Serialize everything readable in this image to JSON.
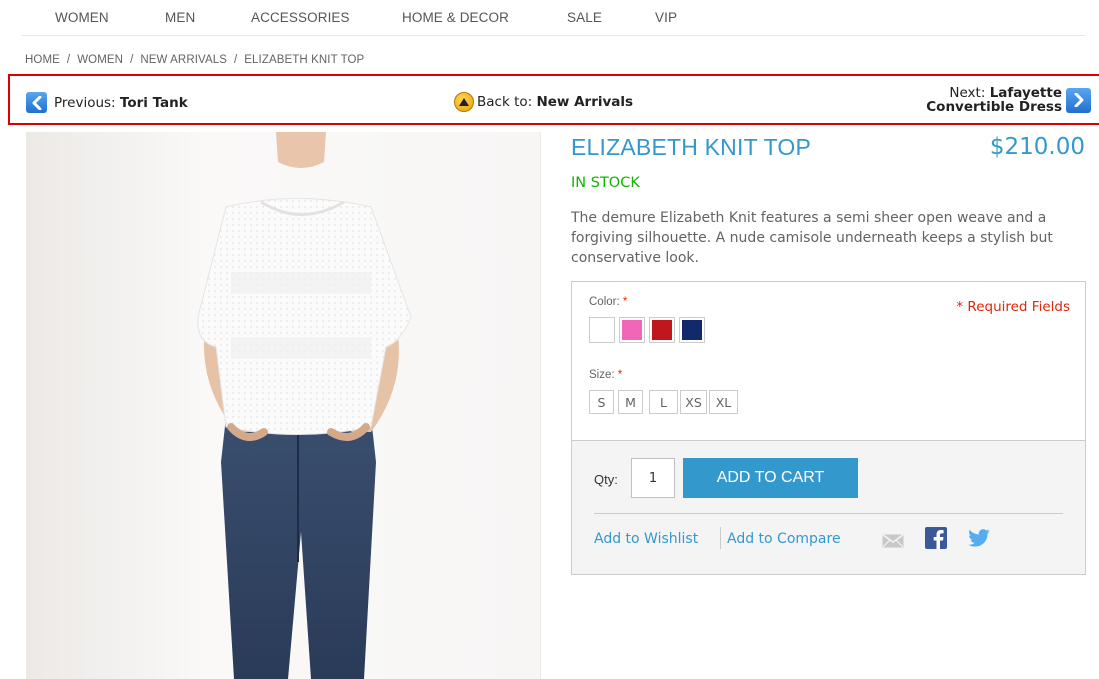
{
  "nav": {
    "items": [
      "WOMEN",
      "MEN",
      "ACCESSORIES",
      "HOME & DECOR",
      "SALE",
      "VIP"
    ]
  },
  "breadcrumb": [
    "HOME",
    "WOMEN",
    "NEW ARRIVALS",
    "ELIZABETH KNIT TOP"
  ],
  "prevnext": {
    "prev_prefix": "Previous:",
    "prev_name": "Tori Tank",
    "back_prefix": "Back to:",
    "back_name": "New Arrivals",
    "next_prefix": "Next:",
    "next_name_line1": "Lafayette",
    "next_name_line2": "Convertible Dress"
  },
  "product": {
    "title": "ELIZABETH KNIT TOP",
    "price": "$210.00",
    "availability": "IN STOCK",
    "description": "The demure Elizabeth Knit features a semi sheer open weave and a forgiving silhouette. A nude camisole underneath keeps a stylish but conservative look."
  },
  "options": {
    "color_label": "Color:",
    "size_label": "Size:",
    "required_marker": "*",
    "required_fields": "* Required Fields",
    "swatches": [
      {
        "name": "white",
        "hex": "#ffffff"
      },
      {
        "name": "pink",
        "hex": "#f067b8"
      },
      {
        "name": "red",
        "hex": "#c0161d"
      },
      {
        "name": "navy",
        "hex": "#13296e"
      }
    ],
    "sizes": [
      "S",
      "M",
      "L",
      "XS",
      "XL"
    ]
  },
  "cart": {
    "qty_label": "Qty:",
    "qty_value": "1",
    "add_to_cart": "ADD TO CART",
    "wishlist": "Add to Wishlist",
    "compare": "Add to Compare"
  },
  "colors": {
    "accent": "#3399cc",
    "in_stock": "#11b400",
    "required": "#df280a",
    "highlight_border": "#dd0000"
  },
  "icons": {
    "prev": "chevron-left-icon",
    "back": "up-arrow-circle-icon",
    "next": "chevron-right-icon",
    "email": "email-icon",
    "facebook": "facebook-icon",
    "twitter": "twitter-icon"
  }
}
